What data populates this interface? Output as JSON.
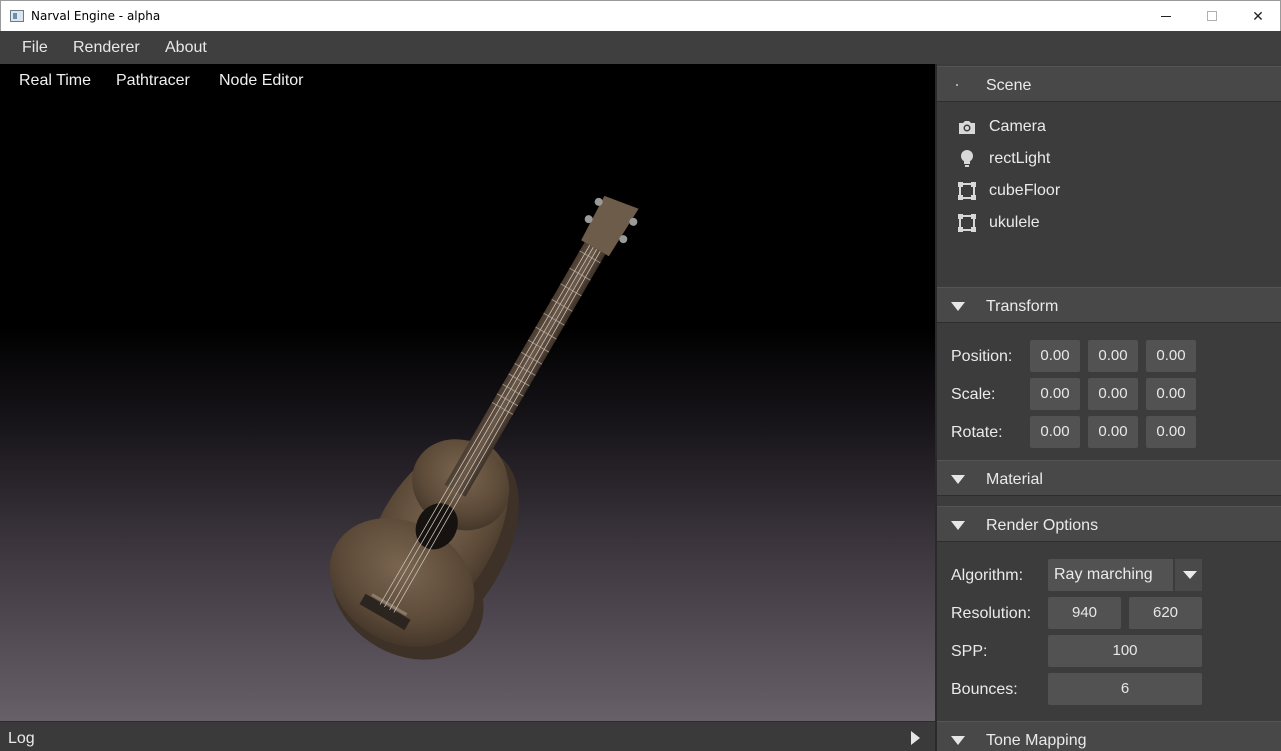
{
  "window": {
    "title": "Narval Engine - alpha",
    "close_glyph": "✕"
  },
  "menubar": {
    "items": [
      "File",
      "Renderer",
      "About"
    ]
  },
  "viewport": {
    "tabs": [
      "Real Time",
      "Pathtracer",
      "Node Editor"
    ]
  },
  "log": {
    "label": "Log"
  },
  "scene": {
    "header": "Scene",
    "items": [
      {
        "icon": "camera-icon",
        "name": "Camera"
      },
      {
        "icon": "lightbulb-icon",
        "name": "rectLight"
      },
      {
        "icon": "mesh-icon",
        "name": "cubeFloor"
      },
      {
        "icon": "mesh-icon",
        "name": "ukulele"
      }
    ]
  },
  "transform": {
    "header": "Transform",
    "rows": [
      {
        "label": "Position:",
        "values": [
          "0.00",
          "0.00",
          "0.00"
        ]
      },
      {
        "label": "Scale:",
        "values": [
          "0.00",
          "0.00",
          "0.00"
        ]
      },
      {
        "label": "Rotate:",
        "values": [
          "0.00",
          "0.00",
          "0.00"
        ]
      }
    ]
  },
  "material": {
    "header": "Material"
  },
  "render_options": {
    "header": "Render Options",
    "algorithm_label": "Algorithm:",
    "algorithm_value": "Ray marching",
    "resolution_label": "Resolution:",
    "resolution_width": "940",
    "resolution_height": "620",
    "spp_label": "SPP:",
    "spp_value": "100",
    "bounces_label": "Bounces:",
    "bounces_value": "6"
  },
  "tone_mapping": {
    "header": "Tone Mapping"
  }
}
